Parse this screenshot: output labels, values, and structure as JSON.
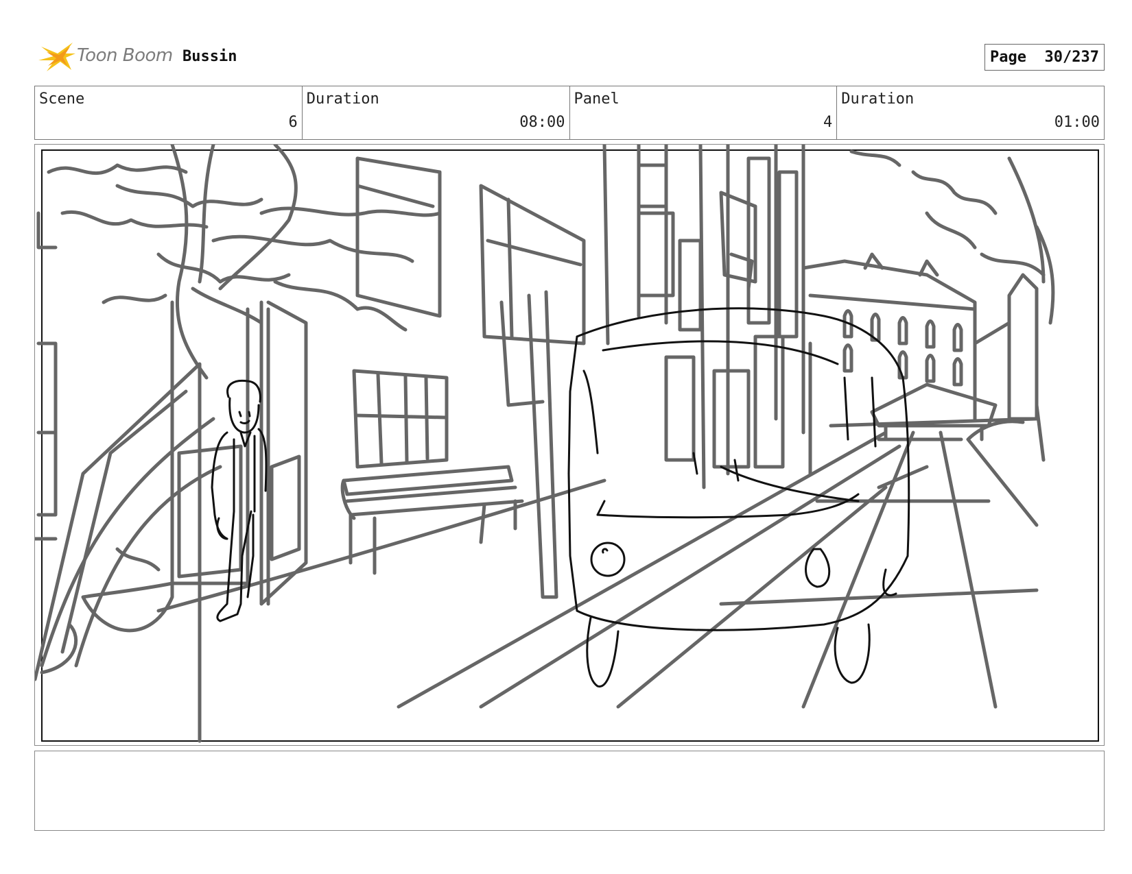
{
  "header": {
    "logo_text": "Toon Boom",
    "project_title": "Bussin",
    "page_label": "Page",
    "page_number": "30/237"
  },
  "info": {
    "scene_label": "Scene",
    "scene_value": "6",
    "scene_duration_label": "Duration",
    "scene_duration_value": "08:00",
    "panel_label": "Panel",
    "panel_value": "4",
    "panel_duration_label": "Duration",
    "panel_duration_value": "01:00"
  },
  "notes": {
    "text": ""
  },
  "colors": {
    "sketch_gray": "#666666",
    "sketch_black": "#111111",
    "logo_yellow": "#f5c21b",
    "logo_orange": "#f39a1a"
  }
}
